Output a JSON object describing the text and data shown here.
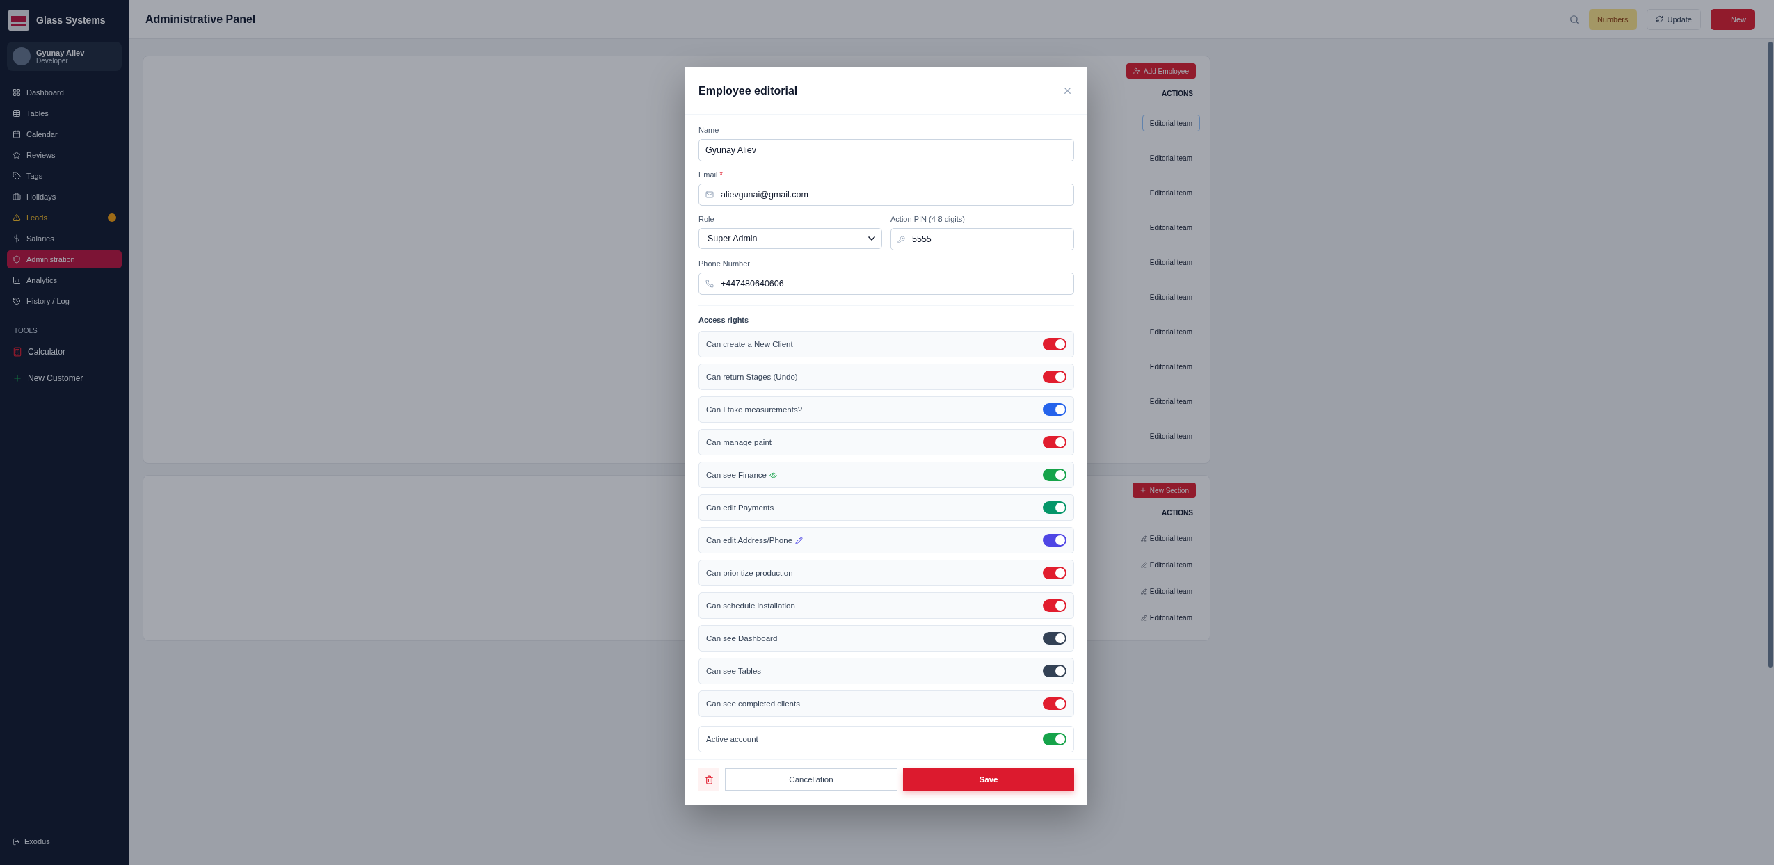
{
  "sidebar": {
    "brand": "Glass Systems",
    "user": {
      "name": "Gyunay Aliev",
      "role": "Developer"
    },
    "items": [
      {
        "label": "Dashboard",
        "selected": false,
        "kind": "plain"
      },
      {
        "label": "Tables",
        "selected": false,
        "kind": "plain"
      },
      {
        "label": "Calendar",
        "selected": false,
        "kind": "plain"
      },
      {
        "label": "Reviews",
        "selected": false,
        "kind": "plain"
      },
      {
        "label": "Tags",
        "selected": false,
        "kind": "plain"
      },
      {
        "label": "Holidays",
        "selected": false,
        "kind": "plain"
      },
      {
        "label": "Leads",
        "selected": false,
        "kind": "alert"
      },
      {
        "label": "Salaries",
        "selected": false,
        "kind": "plain"
      },
      {
        "label": "Administration",
        "selected": true,
        "kind": "plain"
      },
      {
        "label": "Analytics",
        "selected": false,
        "kind": "plain"
      },
      {
        "label": "History / Log",
        "selected": false,
        "kind": "plain"
      }
    ],
    "tools_heading": "TOOLS",
    "tools": [
      {
        "label": "Calculator",
        "kind": "calculator"
      },
      {
        "label": "New Customer",
        "kind": "add"
      }
    ],
    "footer": "Exodus"
  },
  "header": {
    "title": "Administrative Panel",
    "buttons": [
      {
        "label": "Numbers",
        "kind": "badge"
      },
      {
        "label": "Update",
        "kind": "outline"
      },
      {
        "label": "New",
        "kind": "primary"
      }
    ]
  },
  "employees": {
    "add_button": "Add Employee",
    "actions_heading": "ACTIONS",
    "rows": [
      "Editorial team",
      "Editorial team",
      "Editorial team",
      "Editorial team",
      "Editorial team",
      "Editorial team",
      "Editorial team",
      "Editorial team",
      "Editorial team",
      "Editorial team"
    ]
  },
  "sections": {
    "add_button": "New Section",
    "actions_heading": "ACTIONS",
    "rows": [
      "Editorial team",
      "Editorial team",
      "Editorial team",
      "Editorial team"
    ]
  },
  "dialog": {
    "title": "Employee editorial",
    "name": {
      "label": "Name",
      "value": "Gyunay Aliev"
    },
    "email": {
      "label": "Email",
      "required_mark": "*",
      "value": "alievgunai@gmail.com"
    },
    "role": {
      "label": "Role",
      "value": "Super Admin"
    },
    "pin": {
      "label": "Action PIN (4-8 digits)",
      "value": "5555"
    },
    "phone": {
      "label": "Phone Number",
      "value": "+447480640606"
    },
    "rights_heading": "Access rights",
    "rights": [
      {
        "label": "Can create a New Client",
        "on": true,
        "color": "#e11d2e",
        "kind": "plain"
      },
      {
        "label": "Can return Stages (Undo)",
        "on": true,
        "color": "#e11d2e",
        "kind": "plain"
      },
      {
        "label": "Can I take measurements?",
        "on": true,
        "color": "#2563eb",
        "kind": "plain"
      },
      {
        "label": "Can manage paint",
        "on": true,
        "color": "#e11d2e",
        "kind": "plain"
      },
      {
        "label": "Can see Finance",
        "on": true,
        "color": "#16a34a",
        "kind": "eye"
      },
      {
        "label": "Can edit Payments",
        "on": true,
        "color": "#059669",
        "kind": "plain"
      },
      {
        "label": "Can edit Address/Phone",
        "on": true,
        "color": "#4f46e5",
        "kind": "pencil"
      },
      {
        "label": "Can prioritize production",
        "on": true,
        "color": "#e11d2e",
        "kind": "plain"
      },
      {
        "label": "Can schedule installation",
        "on": true,
        "color": "#e11d2e",
        "kind": "plain"
      },
      {
        "label": "Can see Dashboard",
        "on": true,
        "color": "#334155",
        "kind": "plain"
      },
      {
        "label": "Can see Tables",
        "on": true,
        "color": "#334155",
        "kind": "plain"
      },
      {
        "label": "Can see completed clients",
        "on": true,
        "color": "#e11d2e",
        "kind": "plain"
      }
    ],
    "active_account": {
      "label": "Active account",
      "on": true,
      "color": "#16a34a"
    },
    "cancel": "Cancellation",
    "save": "Save"
  }
}
